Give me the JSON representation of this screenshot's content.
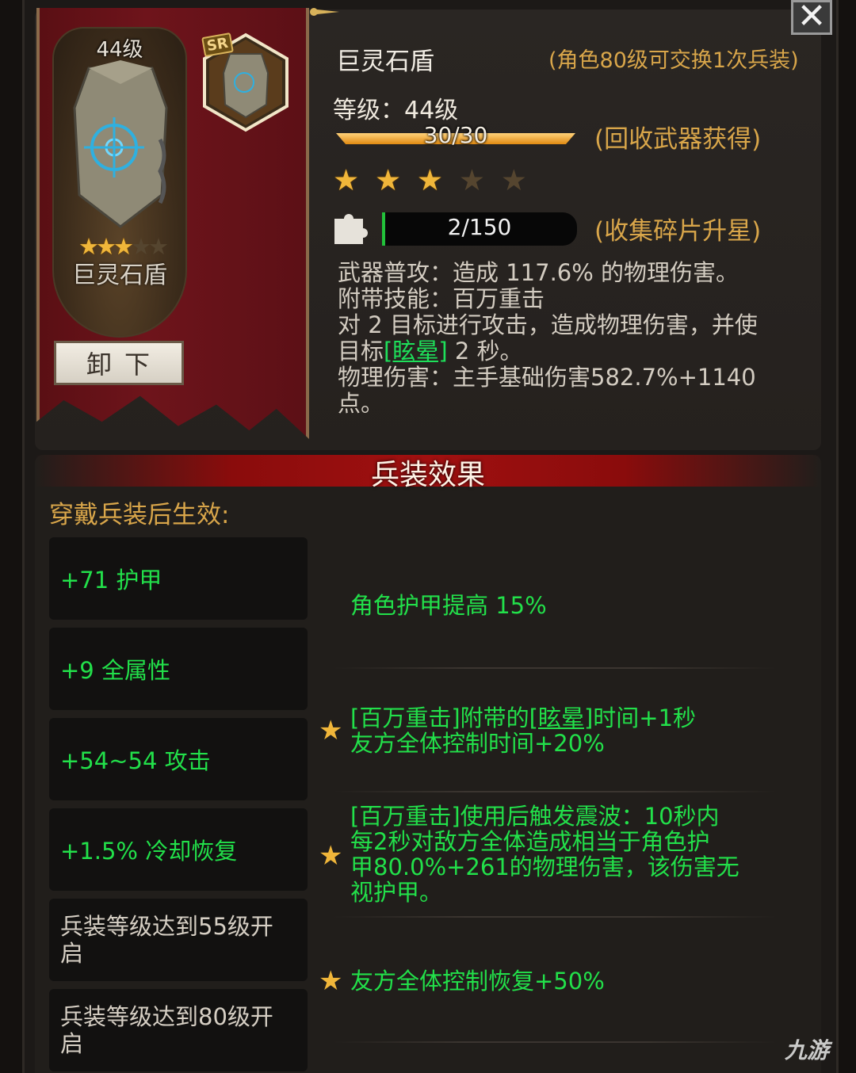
{
  "item": {
    "name": "巨灵石盾",
    "card_level": "44级",
    "rarity": "SR",
    "card_stars": "★★★★★",
    "exchange_note": "(角色80级可交换1次兵装)",
    "level_label": "等级：44级",
    "xp_text": "30/30",
    "xp_progress": 1.0,
    "recycle_note": "(回收武器获得)",
    "stars_filled": 3,
    "stars_total": 5,
    "fragments_text": "2/150",
    "fragments_progress": 0.0133,
    "fragments_note": "(收集碎片升星)",
    "unequip_label": "卸下",
    "close_label": "✕"
  },
  "description": {
    "line1": "武器普攻：造成 117.6% 的物理伤害。",
    "line2": "附带技能：百万重击",
    "line3": "对 2 目标进行攻击，造成物理伤害，并使",
    "line4_prefix": "目标",
    "line4_keyword": "[眩晕]",
    "line4_suffix": " 2 秒。",
    "line5": "物理伤害：主手基础伤害582.7%+1140",
    "line6": "点。"
  },
  "effects": {
    "title": "兵装效果",
    "intro": "穿戴兵装后生效:",
    "stats": [
      "+71 护甲",
      "+9 全属性",
      "+54~54 攻击",
      "+1.5% 冷却恢复",
      "兵装等级达到55级开启",
      "兵装等级达到80级开启"
    ],
    "bonus1": "角色护甲提高 15%",
    "bonus2_a": "[百万重击]附带的",
    "bonus2_kw": "[眩晕]",
    "bonus2_b": "时间+1秒",
    "bonus2_c": "友方全体控制时间+20%",
    "bonus3_l1": "[百万重击]使用后触发震波：10秒内",
    "bonus3_l2": "每2秒对敌方全体造成相当于角色护",
    "bonus3_l3": "甲80.0%+261的物理伤害，该伤害无",
    "bonus3_l4": "视护甲。",
    "bonus4": "友方全体控制恢复+50%"
  },
  "watermark": "九游",
  "colors": {
    "accent_gold": "#d9a64a",
    "effect_green": "#22e04a",
    "banner_red": "#6e141b",
    "star": "#f0b63a"
  }
}
